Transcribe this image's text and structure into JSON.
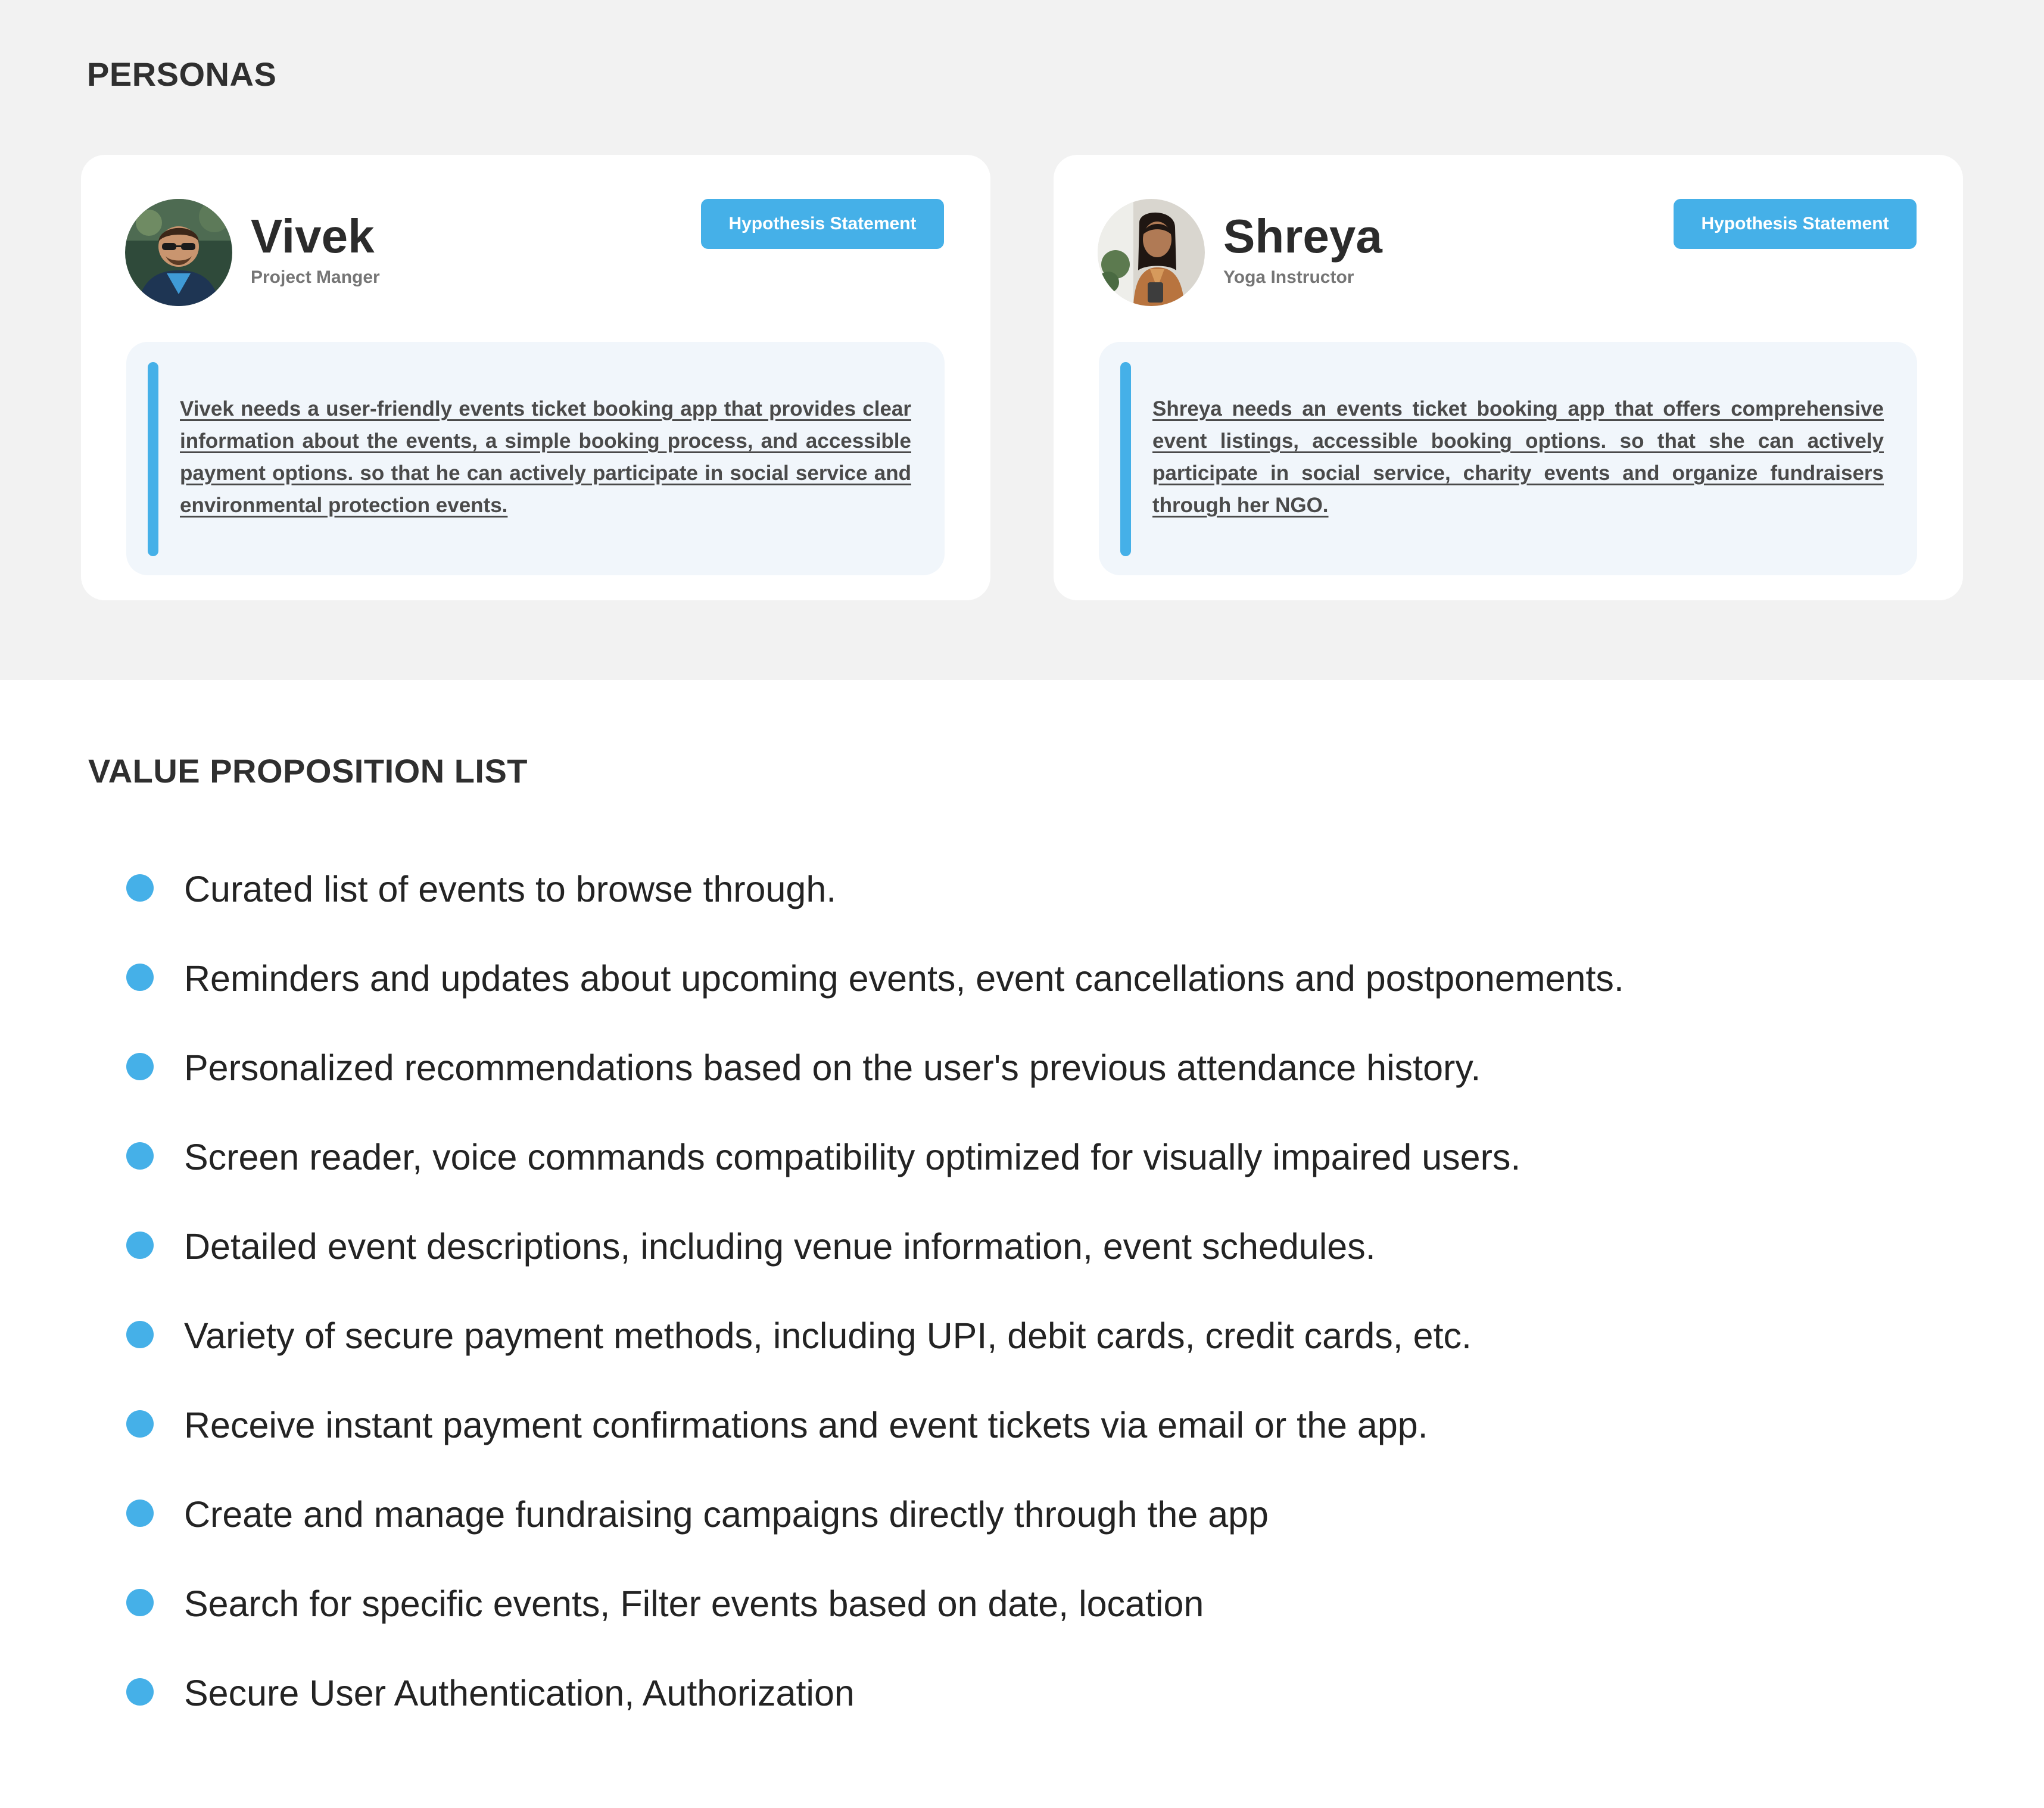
{
  "personas_section": {
    "title": "PERSONAS",
    "background_color": "#f2f2f2"
  },
  "personas": [
    {
      "name": "Vivek",
      "role": "Project Manger",
      "avatar_icon": "person-avatar",
      "badge": "Hypothesis Statement",
      "statement": "Vivek needs a user-friendly events ticket booking app that provides clear information about the events, a simple booking process, and accessible payment options. so that he can actively participate in social service and environmental protection events."
    },
    {
      "name": "Shreya",
      "role": "Yoga Instructor",
      "avatar_icon": "person-avatar",
      "badge": "Hypothesis Statement",
      "statement": "Shreya needs an events ticket booking app that offers comprehensive event listings, accessible booking options. so that she can actively participate in social service, charity events and organize fundraisers through her NGO."
    }
  ],
  "value_section": {
    "title": "VALUE PROPOSITION LIST",
    "items": [
      "Curated list of events to browse through.",
      "Reminders and updates about upcoming events, event cancellations and postponements.",
      "Personalized recommendations based on the user's previous attendance history.",
      "Screen reader, voice commands compatibility optimized for visually impaired users.",
      "Detailed event descriptions, including venue information, event schedules.",
      "Variety of secure payment methods, including UPI, debit cards, credit cards, etc.",
      "Receive instant payment confirmations and event tickets via email or the app.",
      "Create and manage fundraising campaigns directly through the app",
      "Search for specific events, Filter events based on date, location",
      "Secure User Authentication, Authorization"
    ]
  },
  "colors": {
    "accent": "#45b0e8",
    "quote_background": "#f1f6fb",
    "text_dark": "#2f2f2f",
    "text_muted": "#757575"
  }
}
